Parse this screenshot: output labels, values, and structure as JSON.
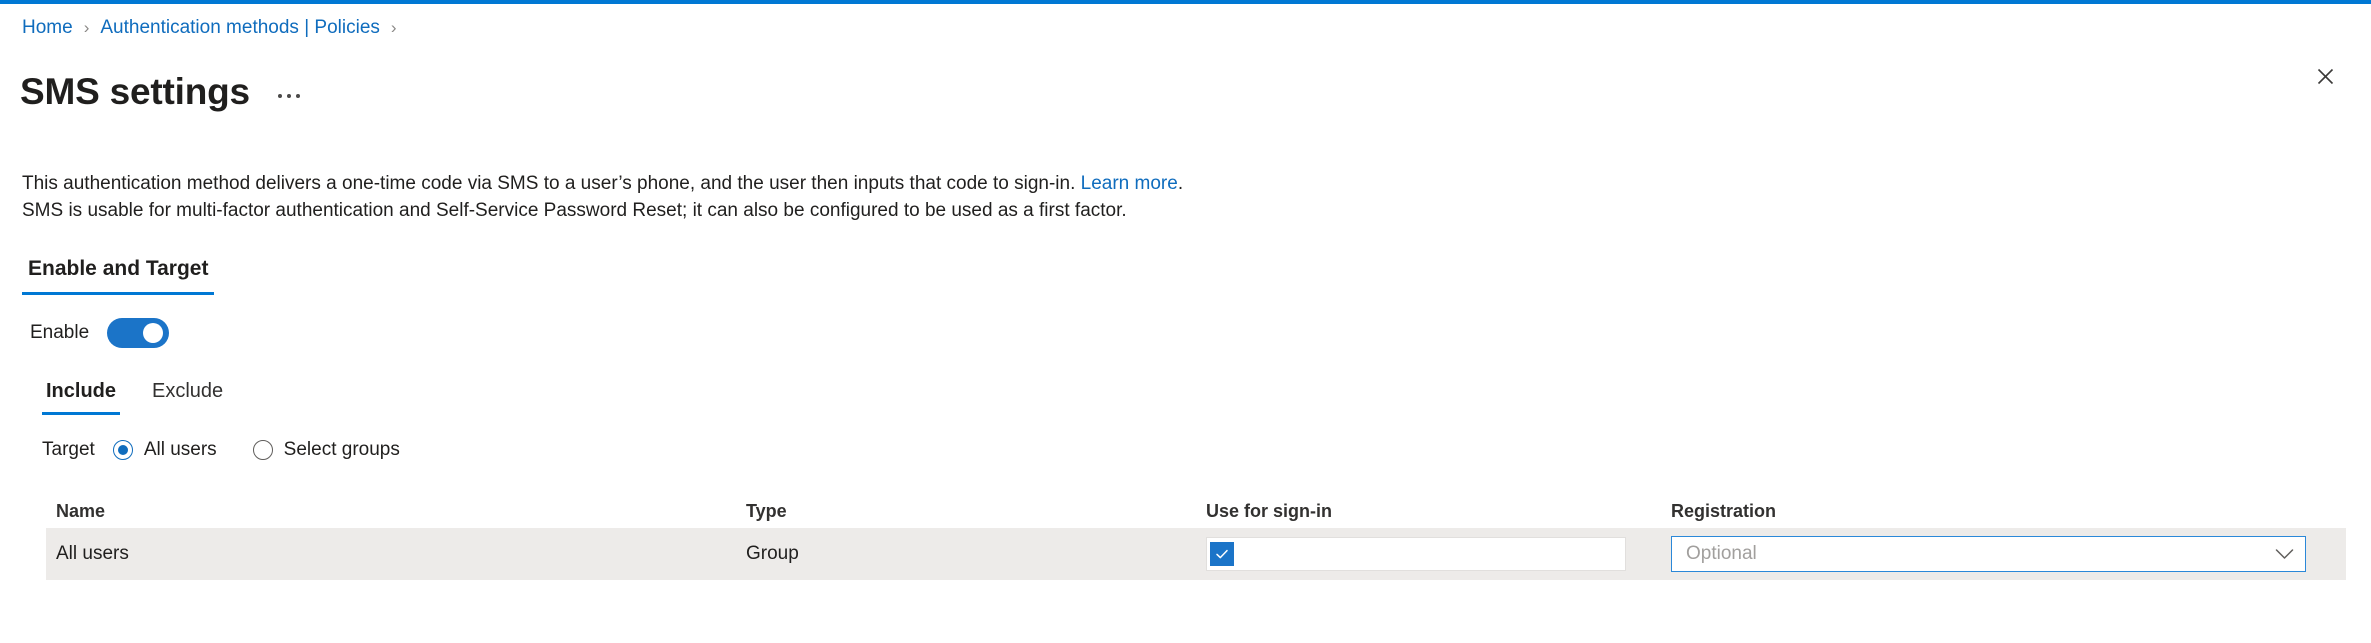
{
  "accent_color": "#0078d4",
  "breadcrumb": {
    "items": [
      {
        "label": "Home"
      },
      {
        "label": "Authentication methods | Policies"
      }
    ],
    "separator": "›"
  },
  "header": {
    "title": "SMS settings",
    "more_menu_label": "...",
    "close_label": "Close"
  },
  "description": {
    "line1_before_link": "This authentication method delivers a one-time code via SMS to a user’s phone, and the user then inputs that code to sign-in. ",
    "link_text": "Learn more",
    "line1_after_link": ".",
    "line2": "SMS is usable for multi-factor authentication and Self-Service Password Reset; it can also be configured to be used as a first factor."
  },
  "pivot": {
    "items": [
      {
        "label": "Enable and Target",
        "active": true
      }
    ]
  },
  "enable": {
    "label": "Enable",
    "toggle_state": "on",
    "toggle_color": "#1b74c8"
  },
  "sub_pivot": {
    "items": [
      {
        "label": "Include",
        "active": true
      },
      {
        "label": "Exclude",
        "active": false
      }
    ]
  },
  "target": {
    "label": "Target",
    "options": [
      {
        "label": "All users",
        "selected": true
      },
      {
        "label": "Select groups",
        "selected": false
      }
    ]
  },
  "table": {
    "columns": [
      "Name",
      "Type",
      "Use for sign-in",
      "Registration"
    ],
    "rows": [
      {
        "name": "All users",
        "type": "Group",
        "use_for_signin_checked": true,
        "registration_value": "",
        "registration_placeholder": "Optional"
      }
    ],
    "row_background": "#edebe9"
  }
}
